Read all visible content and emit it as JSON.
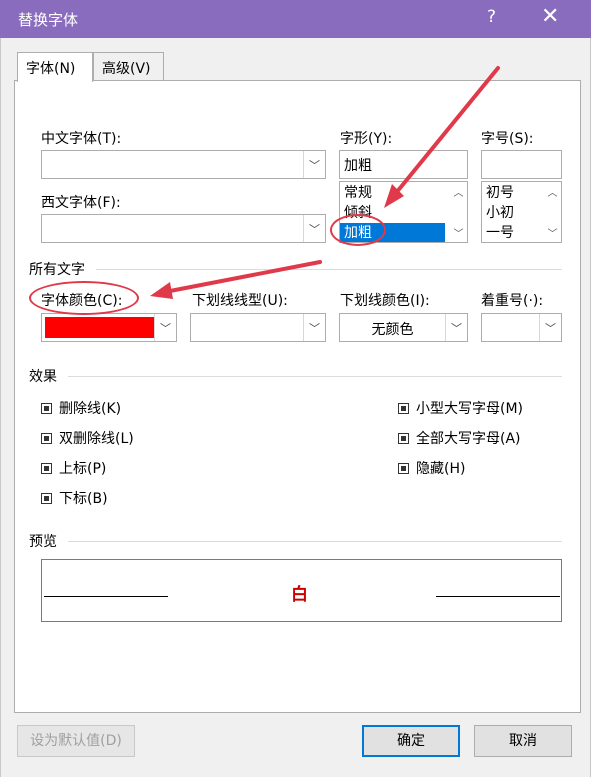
{
  "window": {
    "title": "替换字体",
    "help": "?",
    "close": "✕"
  },
  "tabs": [
    {
      "label": "字体(N)"
    },
    {
      "label": "高级(V)"
    }
  ],
  "fields": {
    "chinese_font_label": "中文字体(T):",
    "western_font_label": "西文字体(F):",
    "style_label": "字形(Y):",
    "style_value": "加粗",
    "style_options": [
      "常规",
      "倾斜",
      "加粗"
    ],
    "size_label": "字号(S):",
    "size_options": [
      "初号",
      "小初",
      "一号"
    ]
  },
  "all_text": {
    "section_label": "所有文字",
    "font_color_label": "字体颜色(C):",
    "font_color_value": "#ff0000",
    "underline_type_label": "下划线线型(U):",
    "underline_color_label": "下划线颜色(I):",
    "underline_color_value": "无颜色",
    "emphasis_label": "着重号(·):"
  },
  "effects": {
    "section_label": "效果",
    "left": [
      "删除线(K)",
      "双删除线(L)",
      "上标(P)",
      "下标(B)"
    ],
    "right": [
      "小型大写字母(M)",
      "全部大写字母(A)",
      "隐藏(H)"
    ]
  },
  "preview": {
    "section_label": "预览",
    "sample_text": "白",
    "sample_color": "#cc0000"
  },
  "buttons": {
    "set_default": "设为默认值(D)",
    "ok": "确定",
    "cancel": "取消"
  },
  "colors": {
    "title_bar": "#8a6cbf",
    "selection": "#0078d7",
    "annotation": "#e0394a"
  }
}
